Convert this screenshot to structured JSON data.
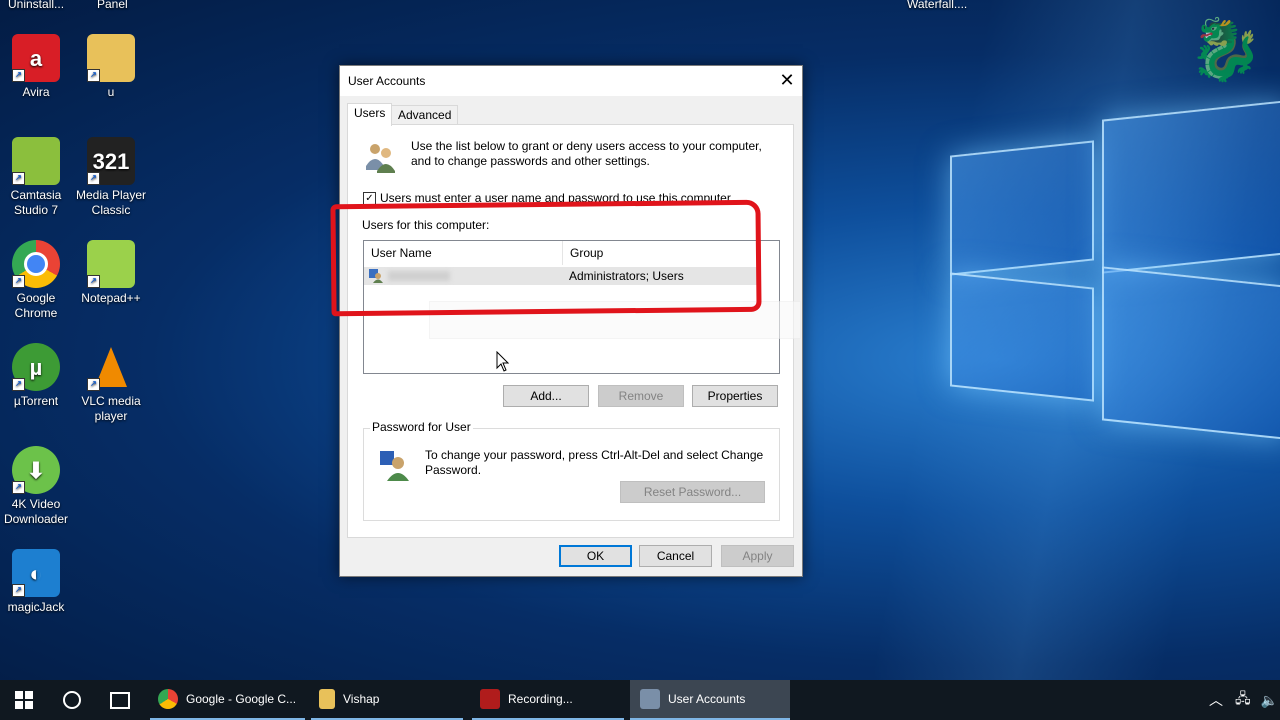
{
  "desktop": {
    "top_labels": [
      "Uninstall...",
      "Panel",
      "Waterfall...."
    ],
    "icons": [
      {
        "label": "Avira",
        "color": "#d81e26"
      },
      {
        "label": "u",
        "color": "#e8c15a"
      },
      {
        "label": "Camtasia Studio 7",
        "color": "#8bbf3d"
      },
      {
        "label": "Media Player Classic",
        "color": "#222222"
      },
      {
        "label": "Google Chrome",
        "color": "#34a853"
      },
      {
        "label": "Notepad++",
        "color": "#9bd14b"
      },
      {
        "label": "µTorrent",
        "color": "#3d9b35"
      },
      {
        "label": "VLC media player",
        "color": "#f08a00"
      },
      {
        "label": "4K Video Downloader",
        "color": "#6cc24a"
      },
      {
        "label": "magicJack",
        "color": "#1d7fd0"
      }
    ]
  },
  "dialog": {
    "title": "User Accounts",
    "close_glyph": "✕",
    "tabs": [
      "Users",
      "Advanced"
    ],
    "intro_text": "Use the list below to grant or deny users access to your computer, and to change passwords and other settings.",
    "checkbox_label": "Users must enter a user name and password to use this computer.",
    "checkbox_checked": true,
    "users_label": "Users for this computer:",
    "columns": [
      "User Name",
      "Group"
    ],
    "rows": [
      {
        "user": "",
        "group": "Administrators; Users"
      }
    ],
    "buttons": {
      "add": "Add...",
      "remove": "Remove",
      "properties": "Properties"
    },
    "password_group": {
      "legend": "Password for User",
      "text": "To change your password, press Ctrl-Alt-Del and select Change Password.",
      "reset": "Reset Password..."
    },
    "footer": {
      "ok": "OK",
      "cancel": "Cancel",
      "apply": "Apply"
    }
  },
  "taskbar": {
    "items": [
      {
        "label": "Google - Google C...",
        "icon": "chrome-icon"
      },
      {
        "label": "Vishap",
        "icon": "folder-icon"
      },
      {
        "label": "Recording...",
        "icon": "recorder-icon"
      },
      {
        "label": "User Accounts",
        "icon": "user-accounts-icon"
      }
    ]
  }
}
